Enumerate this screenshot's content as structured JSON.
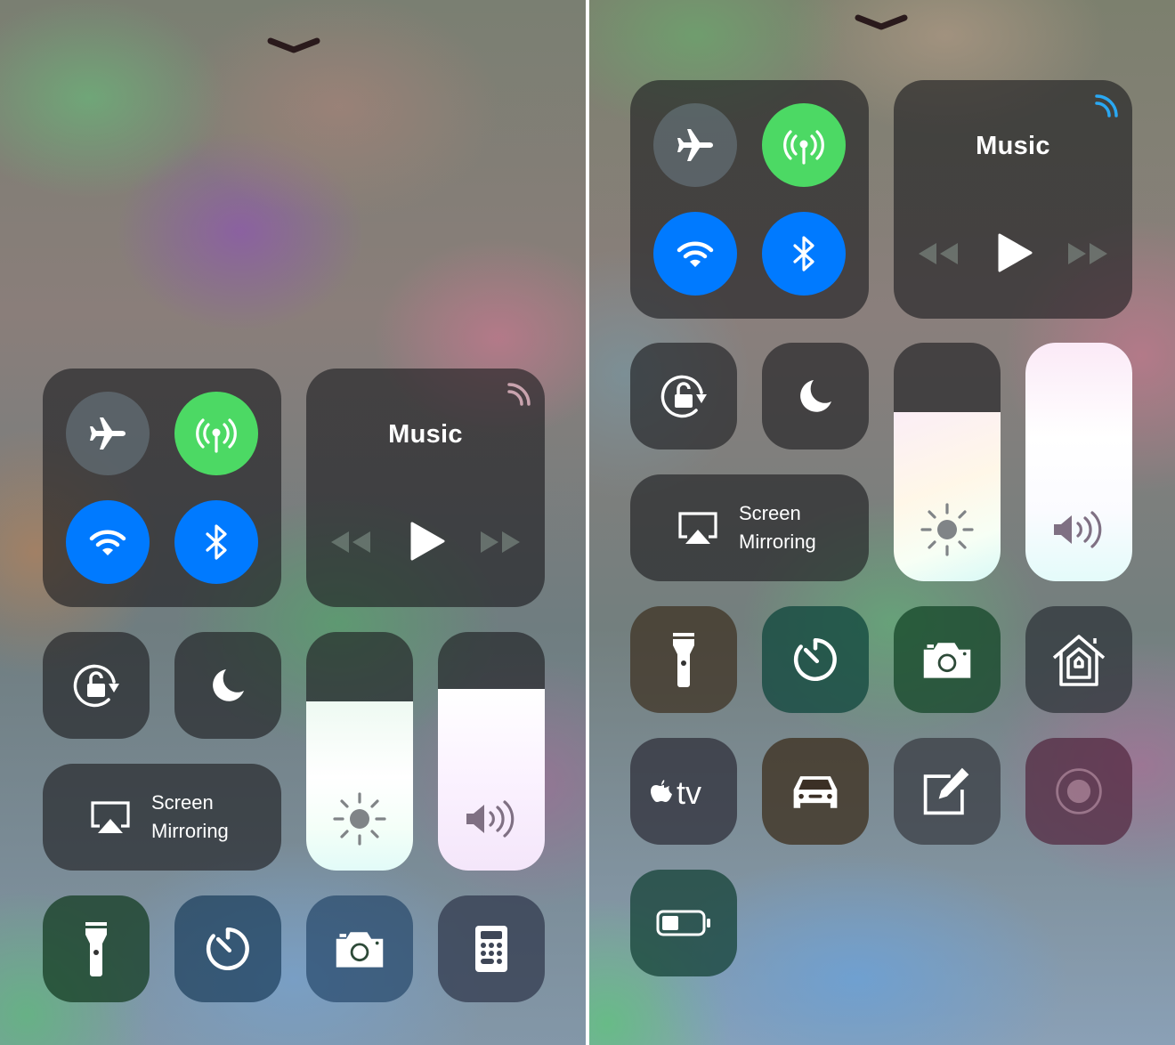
{
  "screens": {
    "left": {
      "dismiss": {
        "icon": "chevron-down-icon"
      },
      "connectivity": {
        "airplane_mode": {
          "icon": "airplane-icon",
          "state": "off"
        },
        "cellular_data": {
          "icon": "cellular-antenna-icon",
          "state": "on",
          "color": "#4cd964"
        },
        "wifi": {
          "icon": "wifi-icon",
          "state": "on",
          "color": "#007aff"
        },
        "bluetooth": {
          "icon": "bluetooth-icon",
          "state": "on",
          "color": "#007aff"
        }
      },
      "music": {
        "title": "Music",
        "airplay_icon": "airplay-audio-icon",
        "airplay_color": "#c9a3ae",
        "controls": [
          "rewind",
          "play",
          "fast-forward"
        ]
      },
      "orientation_lock": {
        "icon": "rotation-lock-icon",
        "state": "off"
      },
      "do_not_disturb": {
        "icon": "moon-icon",
        "state": "off"
      },
      "screen_mirroring": {
        "line1": "Screen",
        "line2": "Mirroring",
        "icon": "airplay-screen-icon"
      },
      "brightness": {
        "icon": "sun-icon",
        "level_percent": 71
      },
      "volume": {
        "icon": "speaker-icon",
        "level_percent": 76
      },
      "shortcuts": [
        {
          "name": "Flashlight",
          "icon": "flashlight-icon"
        },
        {
          "name": "Timer",
          "icon": "timer-icon"
        },
        {
          "name": "Camera",
          "icon": "camera-icon"
        },
        {
          "name": "Calculator",
          "icon": "calculator-icon"
        }
      ]
    },
    "right": {
      "dismiss": {
        "icon": "chevron-down-icon"
      },
      "connectivity": {
        "airplane_mode": {
          "icon": "airplane-icon",
          "state": "off"
        },
        "cellular_data": {
          "icon": "cellular-antenna-icon",
          "state": "on",
          "color": "#4cd964"
        },
        "wifi": {
          "icon": "wifi-icon",
          "state": "on",
          "color": "#007aff"
        },
        "bluetooth": {
          "icon": "bluetooth-icon",
          "state": "on",
          "color": "#007aff"
        }
      },
      "music": {
        "title": "Music",
        "airplay_icon": "airplay-audio-icon",
        "airplay_color": "#2aa8f2",
        "controls": [
          "rewind",
          "play",
          "fast-forward"
        ]
      },
      "orientation_lock": {
        "icon": "rotation-lock-icon",
        "state": "off"
      },
      "do_not_disturb": {
        "icon": "moon-icon",
        "state": "off"
      },
      "screen_mirroring": {
        "line1": "Screen",
        "line2": "Mirroring",
        "icon": "airplay-screen-icon"
      },
      "brightness": {
        "icon": "sun-icon",
        "level_percent": 71
      },
      "volume": {
        "icon": "speaker-icon",
        "level_percent": 100
      },
      "shortcuts": [
        {
          "name": "Flashlight",
          "icon": "flashlight-icon"
        },
        {
          "name": "Timer",
          "icon": "timer-icon"
        },
        {
          "name": "Camera",
          "icon": "camera-icon"
        },
        {
          "name": "Home",
          "icon": "home-icon"
        },
        {
          "name": "Apple TV Remote",
          "icon": "apple-tv-icon",
          "label": "tv"
        },
        {
          "name": "Do Not Disturb While Driving",
          "icon": "car-icon"
        },
        {
          "name": "Notes",
          "icon": "notes-icon"
        },
        {
          "name": "Screen Recording",
          "icon": "screen-record-icon"
        },
        {
          "name": "Low Power Mode",
          "icon": "battery-icon"
        }
      ]
    }
  }
}
